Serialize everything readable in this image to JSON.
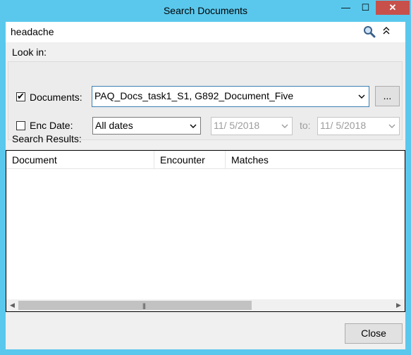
{
  "window": {
    "title": "Search Documents",
    "minimize": "—",
    "maximize": "☐",
    "close": "✕"
  },
  "search": {
    "query": "headache"
  },
  "look_in": {
    "label": "Look in:",
    "documents_label": "Documents:",
    "documents_checked": true,
    "documents_value": "PAQ_Docs_task1_S1, G892_Document_Five",
    "browse_label": "...",
    "enc_date_label": "Enc Date:",
    "enc_date_checked": false,
    "date_range_value": "All dates",
    "from_date": "11/  5/2018",
    "to_label": "to:",
    "to_date": "11/  5/2018"
  },
  "results": {
    "label": "Search Results:",
    "columns": [
      "Document",
      "Encounter",
      "Matches"
    ],
    "rows": []
  },
  "footer": {
    "close_label": "Close"
  },
  "colors": {
    "title_bar": "#5ac8ed",
    "close_button": "#c7504b"
  }
}
